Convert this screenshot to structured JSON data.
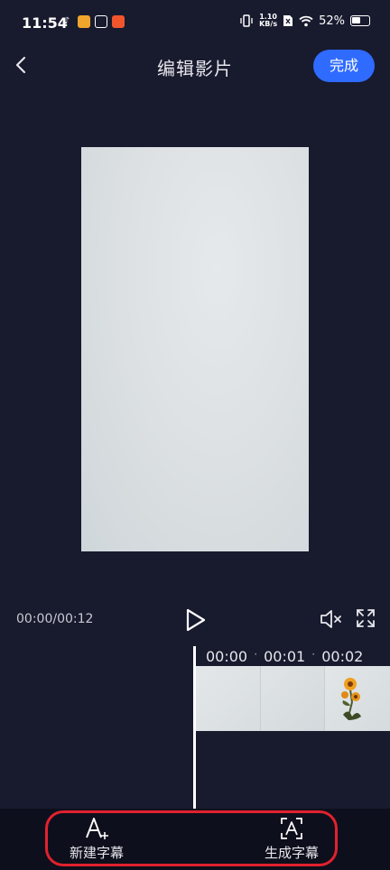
{
  "status_bar": {
    "time": "11:54",
    "notif_icons": [
      "tiktok-icon",
      "app-icon-orange",
      "app-icon-red-box",
      "app-icon-red"
    ],
    "net_speed_top": "1.10",
    "net_speed_bottom": "KB/s",
    "battery": "52%"
  },
  "header": {
    "title": "编辑影片",
    "done_label": "完成"
  },
  "player": {
    "timecode": "00:00/00:12"
  },
  "timeline": {
    "ticks": [
      "00:00",
      "00:01",
      "00:02"
    ]
  },
  "toolbar": {
    "new_subtitle_label": "新建字幕",
    "generate_subtitle_label": "生成字幕"
  },
  "colors": {
    "background": "#181a2e",
    "accent": "#2f6bff",
    "highlight": "#e0222e"
  }
}
